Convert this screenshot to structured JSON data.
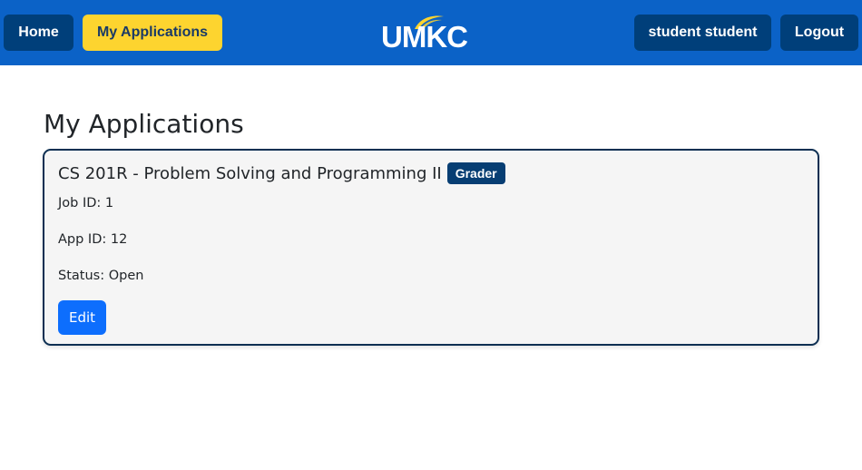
{
  "colors": {
    "navbar": "#0b62c7",
    "nav_button": "#003f7a",
    "nav_active": "#fdd42f",
    "card_border": "#0d2f52",
    "badge": "#073e73",
    "primary_button": "#0d6efd"
  },
  "nav": {
    "home_label": "Home",
    "apps_label": "My Applications",
    "user_label": "student student",
    "logout_label": "Logout",
    "logo_text": "UMKC",
    "logo_icon": "umkc-flame-logo"
  },
  "page": {
    "title": "My Applications"
  },
  "applications": [
    {
      "title": "CS 201R - Problem Solving and Programming II",
      "badge": "Grader",
      "job_id": "Job ID: 1",
      "app_id": "App ID: 12",
      "status": "Status: Open",
      "edit_label": "Edit"
    }
  ]
}
